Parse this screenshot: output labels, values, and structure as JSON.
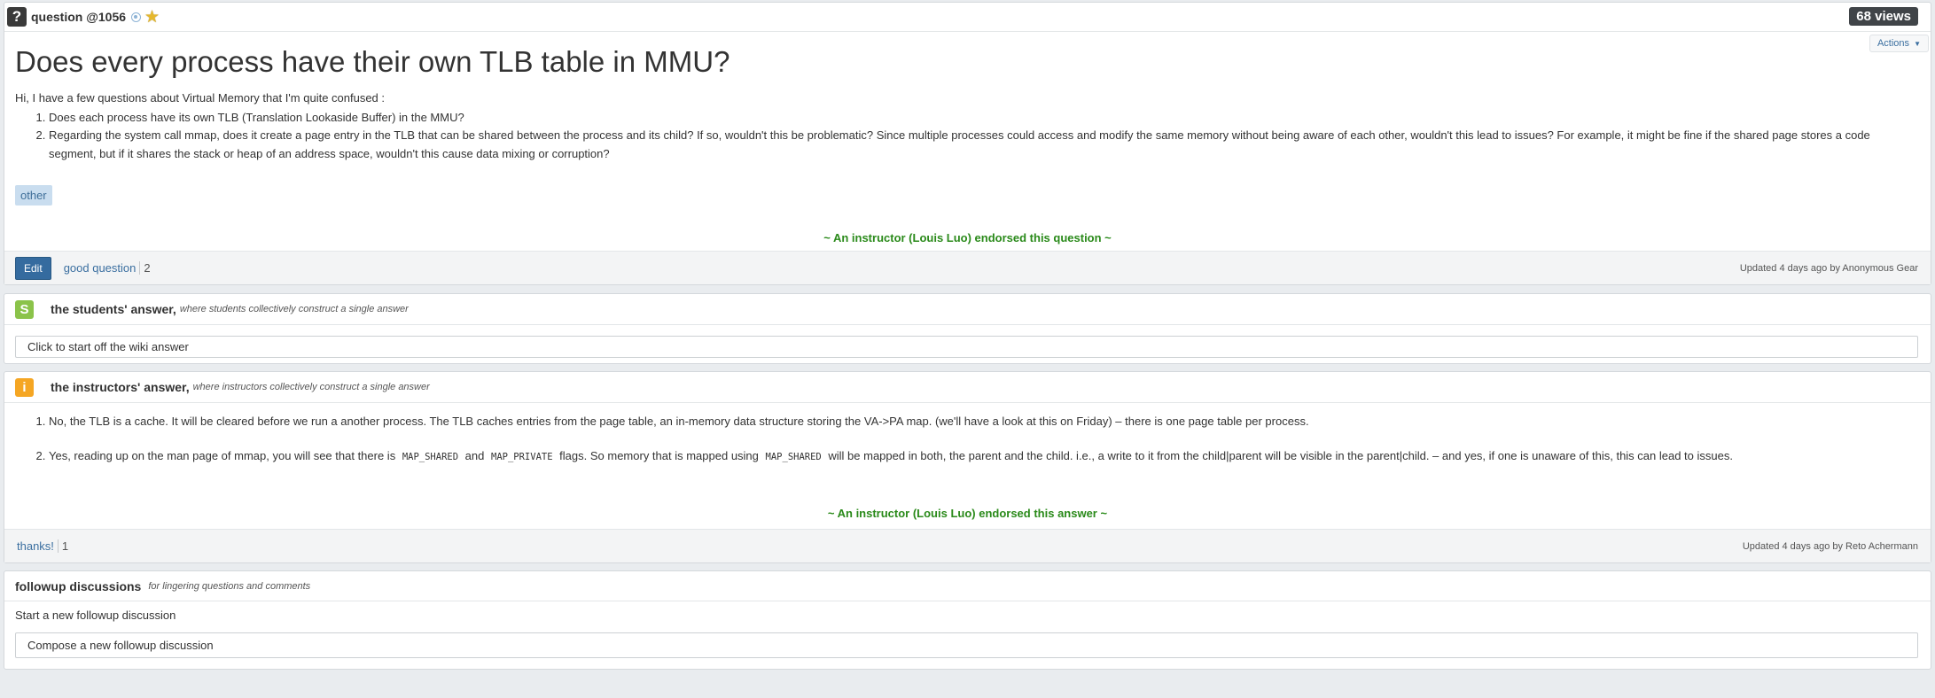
{
  "question": {
    "type_icon": "question-mark-icon",
    "type_glyph": "?",
    "label": "question @1056",
    "views": "68 views",
    "actions_label": "Actions",
    "title": "Does every process have their own TLB table in MMU?",
    "intro": "Hi, I have a few questions about Virtual Memory that I'm quite confused :",
    "items": [
      "Does each process have its own TLB (Translation Lookaside Buffer) in the MMU?",
      "Regarding the system call mmap, does it create a page entry in the TLB that can be shared between the process and its child? If so, wouldn't this be problematic? Since multiple processes could access and modify the same memory without being aware of each other, wouldn't this lead to issues? For example, it might be fine if the shared page stores a code segment, but if it shares the stack or heap of an address space, wouldn't this cause data mixing or corruption?"
    ],
    "tag": "other",
    "endorsement": "~ An instructor (Louis Luo) endorsed this question ~",
    "edit_label": "Edit",
    "good_question_label": "good question",
    "good_question_count": "2",
    "updated": "Updated 4 days ago by Anonymous Gear"
  },
  "students_answer": {
    "icon_glyph": "S",
    "title": "the students' answer,",
    "subtitle": "where students collectively construct a single answer",
    "placeholder": "Click to start off the wiki answer"
  },
  "instructors_answer": {
    "icon_glyph": "i",
    "title": "the instructors' answer,",
    "subtitle": "where instructors collectively construct a single answer",
    "item1": "No, the TLB is a cache. It will be cleared before we run a another process. The TLB caches entries from the page table, an in-memory data structure storing the VA->PA map. (we'll have a look at this on Friday) – there is one page table per process.",
    "item2_a": "Yes, reading up on the man page of mmap, you will see that there is",
    "item2_code1": "MAP_SHARED",
    "item2_b": "and",
    "item2_code2": "MAP_PRIVATE",
    "item2_c": "flags. So memory that is mapped using",
    "item2_code3": "MAP_SHARED",
    "item2_d": "will be mapped in both, the parent and the child. i.e., a write to it from the child|parent will be visible in the parent|child. – and yes, if one is unaware of this, this can lead to issues.",
    "endorsement": "~ An instructor (Louis Luo) endorsed this answer ~",
    "thanks_label": "thanks!",
    "thanks_count": "1",
    "updated": "Updated 4 days ago by Reto Achermann"
  },
  "followup": {
    "title": "followup discussions",
    "subtitle": "for lingering questions and comments",
    "start_label": "Start a new followup discussion",
    "compose_placeholder": "Compose a new followup discussion"
  },
  "colors": {
    "endorse_green": "#2a8a1a",
    "link_blue": "#3b6fa0",
    "edit_button": "#356b9f",
    "students_icon": "#8bc34a",
    "instructors_icon": "#f5a623",
    "star": "#e6b82d"
  }
}
